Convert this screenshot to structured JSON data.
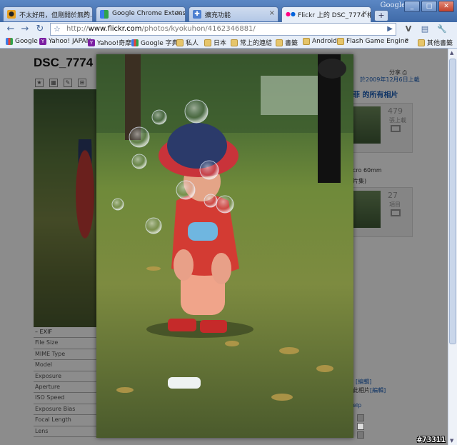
{
  "window": {
    "brand": "Google",
    "buttons": [
      "_",
      "□",
      "✕"
    ]
  },
  "tabs": [
    {
      "label": "不太好用，但剛開於無的...",
      "fav_color": "#e8a020",
      "active": false
    },
    {
      "label": "Google Chrome Extensions: ...",
      "fav_color": "#3a7be8",
      "active": false
    },
    {
      "label": "擴充功能",
      "fav_color": "#4c7fd0",
      "active": false
    },
    {
      "label": "Flickr 上的 DSC_7774 相...",
      "fav_color": "#ff0084",
      "active": true
    }
  ],
  "new_tab_label": "+",
  "toolbar": {
    "url_scheme": "http://",
    "url_host": "www.flickr.com",
    "url_path": "/photos/kyokuhon/4162346881/",
    "back": "←",
    "forward": "→",
    "reload": "↻",
    "star": "☆",
    "go": "▶",
    "page_menu": "▤",
    "tools_menu": "🔧"
  },
  "bookmarks": [
    {
      "label": "Google",
      "icon": "google-icon"
    },
    {
      "label": "Yahoo! JAPAN",
      "icon": "yahoo-icon"
    },
    {
      "label": "Yahoo!奇摩",
      "icon": "yahoo-icon"
    },
    {
      "label": "Google 字典",
      "icon": "google-icon"
    },
    {
      "label": "私人",
      "icon": "folder-icon"
    },
    {
      "label": "日本",
      "icon": "folder-icon"
    },
    {
      "label": "常上的連結",
      "icon": "folder-icon"
    },
    {
      "label": "書籤",
      "icon": "folder-icon"
    },
    {
      "label": "Android",
      "icon": "folder-icon"
    },
    {
      "label": "Flash Game Engine",
      "icon": "folder-icon"
    }
  ],
  "bookmarks_overflow": "»",
  "other_bookmarks": "其他書籤",
  "page": {
    "title": "DSC_7774",
    "date_text": "於2009年12月6日上載",
    "sets_heading": "菲 的所有相片",
    "card1": {
      "num": "479",
      "unit": "張上載"
    },
    "lens_text": "cro 60mm",
    "lens_sub": "片集)",
    "card2": {
      "num": "27",
      "unit": "項目"
    },
    "share_label": "分享",
    "edit1": "[編輯]",
    "edit2_prefix": "此相片",
    "edit2": "[編輯]",
    "help": "elp",
    "exif_rows": [
      "– EXIF",
      "File Size",
      "MIME Type",
      "Model",
      "Exposure",
      "Aperture",
      "ISO Speed",
      "Exposure Bias",
      "Focal Length",
      "Lens"
    ]
  },
  "watermark": "#73311"
}
